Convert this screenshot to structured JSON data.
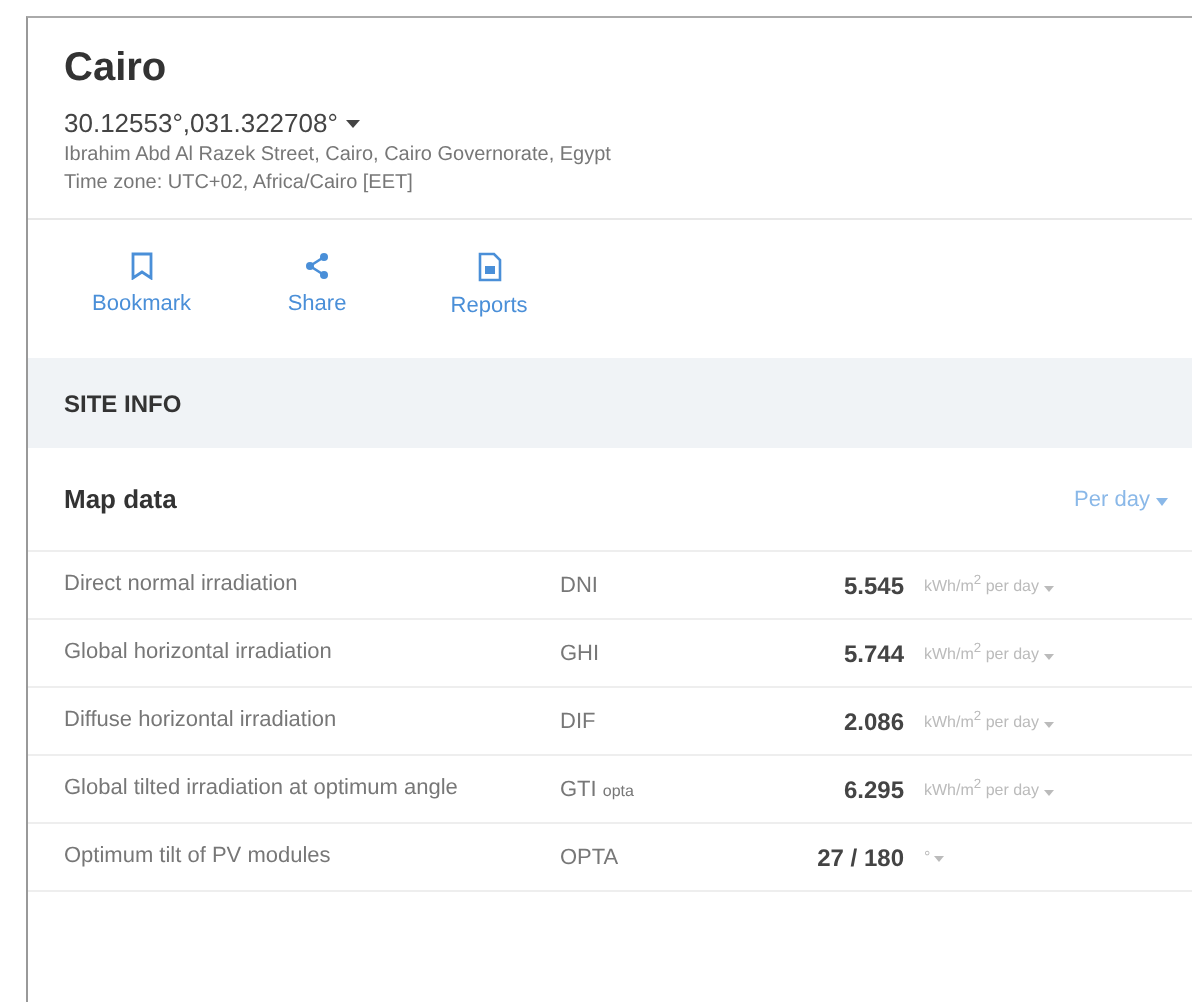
{
  "location": {
    "title": "Cairo",
    "coordinates": "30.12553°,031.322708°",
    "address": "Ibrahim Abd Al Razek Street, Cairo, Cairo Governorate, Egypt",
    "timezone": "Time zone: UTC+02, Africa/Cairo [EET]"
  },
  "actions": [
    {
      "kind": "bookmark",
      "label": "Bookmark"
    },
    {
      "kind": "share",
      "label": "Share"
    },
    {
      "kind": "reports",
      "label": "Reports"
    }
  ],
  "section": "SITE INFO",
  "map_data": {
    "title": "Map data",
    "period": "Per day",
    "rows": [
      {
        "name": "Direct normal irradiation",
        "abbr": "DNI",
        "value": "5.545",
        "unit": "kWh/m$^{2}$ per day"
      },
      {
        "name": "Global horizontal irradiation",
        "abbr": "GHI",
        "value": "5.744",
        "unit": "kWh/m$^{2}$ per day"
      },
      {
        "name": "Diffuse horizontal irradiation",
        "abbr": "DIF",
        "value": "2.086",
        "unit": "kWh/m$^{2}$ per day"
      },
      {
        "name": "Global tilted irradiation at optimum angle",
        "abbr": "GTI $_{opta}$",
        "value": "6.295",
        "unit": "kWh/m$^{2}$ per day"
      },
      {
        "name": "Optimum tilt of PV modules",
        "abbr": "OPTA",
        "value": "27 / 180",
        "unit": "°"
      }
    ]
  }
}
